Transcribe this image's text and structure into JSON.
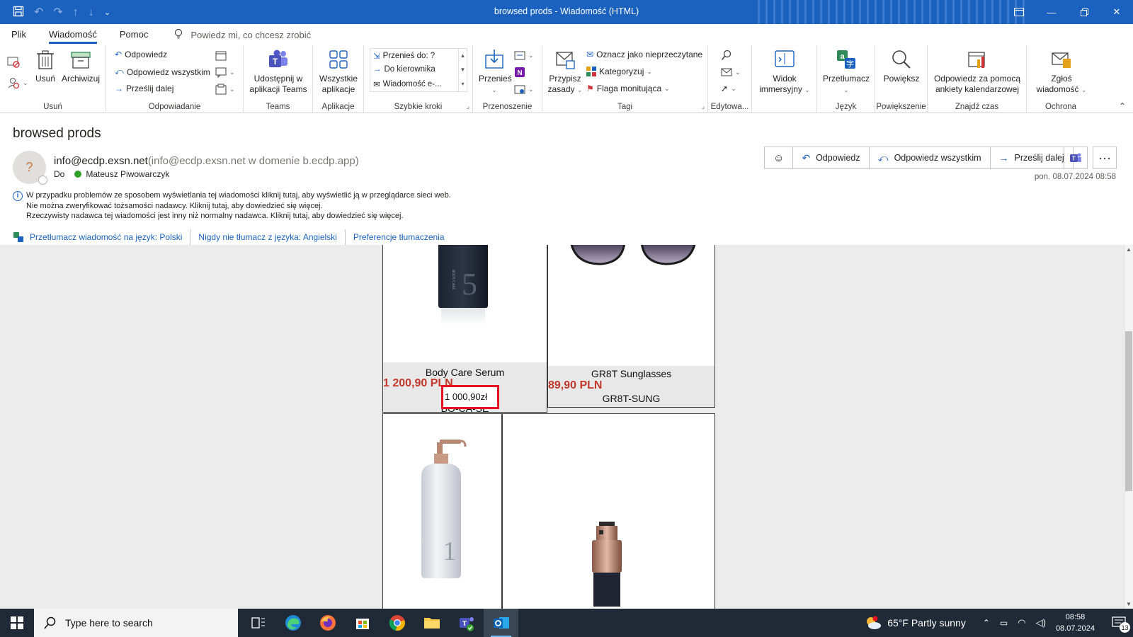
{
  "window": {
    "title": "browsed prods - Wiadomość (HTML)",
    "accent": "#1b62c0"
  },
  "menu": {
    "tabs": [
      "Plik",
      "Wiadomość",
      "Pomoc"
    ],
    "active_tab": "Wiadomość",
    "tell_me": "Powiedz mi, co chcesz zrobić"
  },
  "ribbon": {
    "usun": {
      "label": "Usuń",
      "delete": "Usuń",
      "archive": "Archiwizuj"
    },
    "odpowiadanie": {
      "label": "Odpowiadanie",
      "reply": "Odpowiedz",
      "reply_all": "Odpowiedz wszystkim",
      "forward": "Prześlij dalej"
    },
    "teams": {
      "label": "Teams",
      "share": "Udostępnij w aplikacji Teams"
    },
    "aplikacje": {
      "label": "Aplikacje",
      "all_apps": "Wszystkie aplikacje"
    },
    "szybkie_kroki": {
      "label": "Szybkie kroki",
      "items": [
        "Przenieś do: ?",
        "Do kierownika",
        "Wiadomość e-..."
      ]
    },
    "przenoszenie": {
      "label": "Przenoszenie",
      "move": "Przenieś"
    },
    "tagi": {
      "label": "Tagi",
      "rules": "Przypisz zasady",
      "mark_unread": "Oznacz jako nieprzeczytane",
      "categorize": "Kategoryzuj",
      "flag": "Flaga monitująca"
    },
    "edytowanie": {
      "label": "Edytowa..."
    },
    "immersive": {
      "label": "Widok immersyjny"
    },
    "jezyk": {
      "label": "Język",
      "translate": "Przetłumacz"
    },
    "powiekszenie": {
      "label": "Powiększenie",
      "zoom": "Powiększ"
    },
    "znajdz_czas": {
      "label": "Znajdź czas",
      "reply_poll": "Odpowiedz za pomocą ankiety kalendarzowej"
    },
    "ochrona": {
      "label": "Ochrona",
      "report": "Zgłoś wiadomość"
    }
  },
  "message": {
    "subject": "browsed prods",
    "avatar_initial": "?",
    "sender_name": "info@ecdp.exsn.net",
    "sender_detail": "(info@ecdp.exsn.net w domenie b.ecdp.app)",
    "to_label": "Do",
    "recipient": "Mateusz Piwowarczyk",
    "datetime": "pon. 08.07.2024 08:58",
    "actions": {
      "reply": "Odpowiedz",
      "reply_all": "Odpowiedz wszystkim",
      "forward": "Prześlij dalej"
    },
    "info_lines": [
      "W przypadku problemów ze sposobem wyświetlania tej wiadomości kliknij tutaj, aby wyświetlić ją w przeglądarce sieci web.",
      "Nie można zweryfikować tożsamości nadawcy. Kliknij tutaj, aby dowiedzieć się więcej.",
      "Rzeczywisty nadawca tej wiadomości jest inny niż normalny nadawca. Kliknij tutaj, aby dowiedzieć się więcej."
    ],
    "translate_links": [
      "Przetłumacz wiadomość na język: Polski",
      "Nigdy nie tłumacz z języka: Angielski",
      "Preferencje tłumaczenia"
    ]
  },
  "products": [
    {
      "name": "Body Care Serum",
      "price": "1 200,90 PLN",
      "sale_price": "1 000,90zł",
      "sku": "BO-CA-SE"
    },
    {
      "name": "GR8T Sunglasses",
      "price": "89,90 PLN",
      "sku": "GR8T-SUNG"
    }
  ],
  "bottle_label": "BODY CARE",
  "taskbar": {
    "search_placeholder": "Type here to search",
    "weather": "65°F  Partly sunny",
    "time": "08:58",
    "date": "08.07.2024",
    "notifications": "13"
  }
}
